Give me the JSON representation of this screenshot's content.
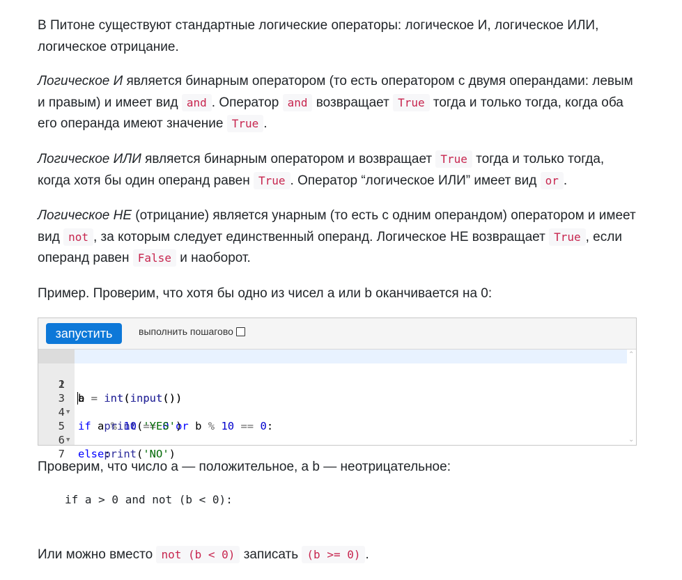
{
  "p1": "В Питоне существуют стандартные логические операторы: логическое И, логическое ИЛИ, логическое отрицание.",
  "p2": {
    "em": "Логическое И",
    "t1": " является бинарным оператором (то есть оператором с двумя операндами: левым и правым) и имеет вид ",
    "c1": "and",
    "t2": ". Оператор ",
    "c2": "and",
    "t3": " возвращает ",
    "c3": "True",
    "t4": " тогда и только тогда, когда оба его операнда имеют значение ",
    "c4": "True",
    "t5": "."
  },
  "p3": {
    "em": "Логическое ИЛИ",
    "t1": " является бинарным оператором и возвращает ",
    "c1": "True",
    "t2": " тогда и только тогда, когда хотя бы один операнд равен ",
    "c2": "True",
    "t3": ". Оператор “логическое ИЛИ” имеет вид ",
    "c3": "or",
    "t4": "."
  },
  "p4": {
    "em": "Логическое НЕ",
    "t1": " (отрицание) является унарным (то есть с одним операндом) оператором и имеет вид ",
    "c1": "not",
    "t2": ", за которым следует единственный операнд. Логическое НЕ возвращает ",
    "c2": "True",
    "t3": ", если операнд равен ",
    "c3": "False",
    "t4": " и наоборот."
  },
  "p5": "Пример. Проверим, что хотя бы одно из чисел a или b оканчивается на 0:",
  "runner": {
    "run_label": "запустить",
    "step_label": "выполнить пошагово",
    "line_numbers": [
      "1",
      "2",
      "3",
      "4",
      "5",
      "6",
      "7"
    ]
  },
  "code_tokens": {
    "l1": [
      "a",
      " = ",
      "int",
      "(",
      "input",
      "())"
    ],
    "l2": [
      "b",
      " = ",
      "int",
      "(",
      "input",
      "())"
    ],
    "l3": [
      "if",
      " a ",
      "%",
      " ",
      "10",
      " ",
      "==",
      " ",
      "0",
      " ",
      "or",
      " b ",
      "%",
      " ",
      "10",
      " ",
      "==",
      " ",
      "0",
      ":"
    ],
    "l4": [
      "    ",
      "print",
      "(",
      "'YES'",
      ")"
    ],
    "l5": [
      "else",
      ":"
    ],
    "l6": [
      "    ",
      "print",
      "(",
      "'NO'",
      ")"
    ]
  },
  "p6": "Проверим, что число a — положительное, а b — неотрицательное:",
  "pre": "if a > 0 and not (b < 0):",
  "p7": {
    "t1": "Или можно вместо ",
    "c1": "not (b < 0)",
    "t2": " записать ",
    "c2": "(b >= 0)",
    "t3": "."
  }
}
